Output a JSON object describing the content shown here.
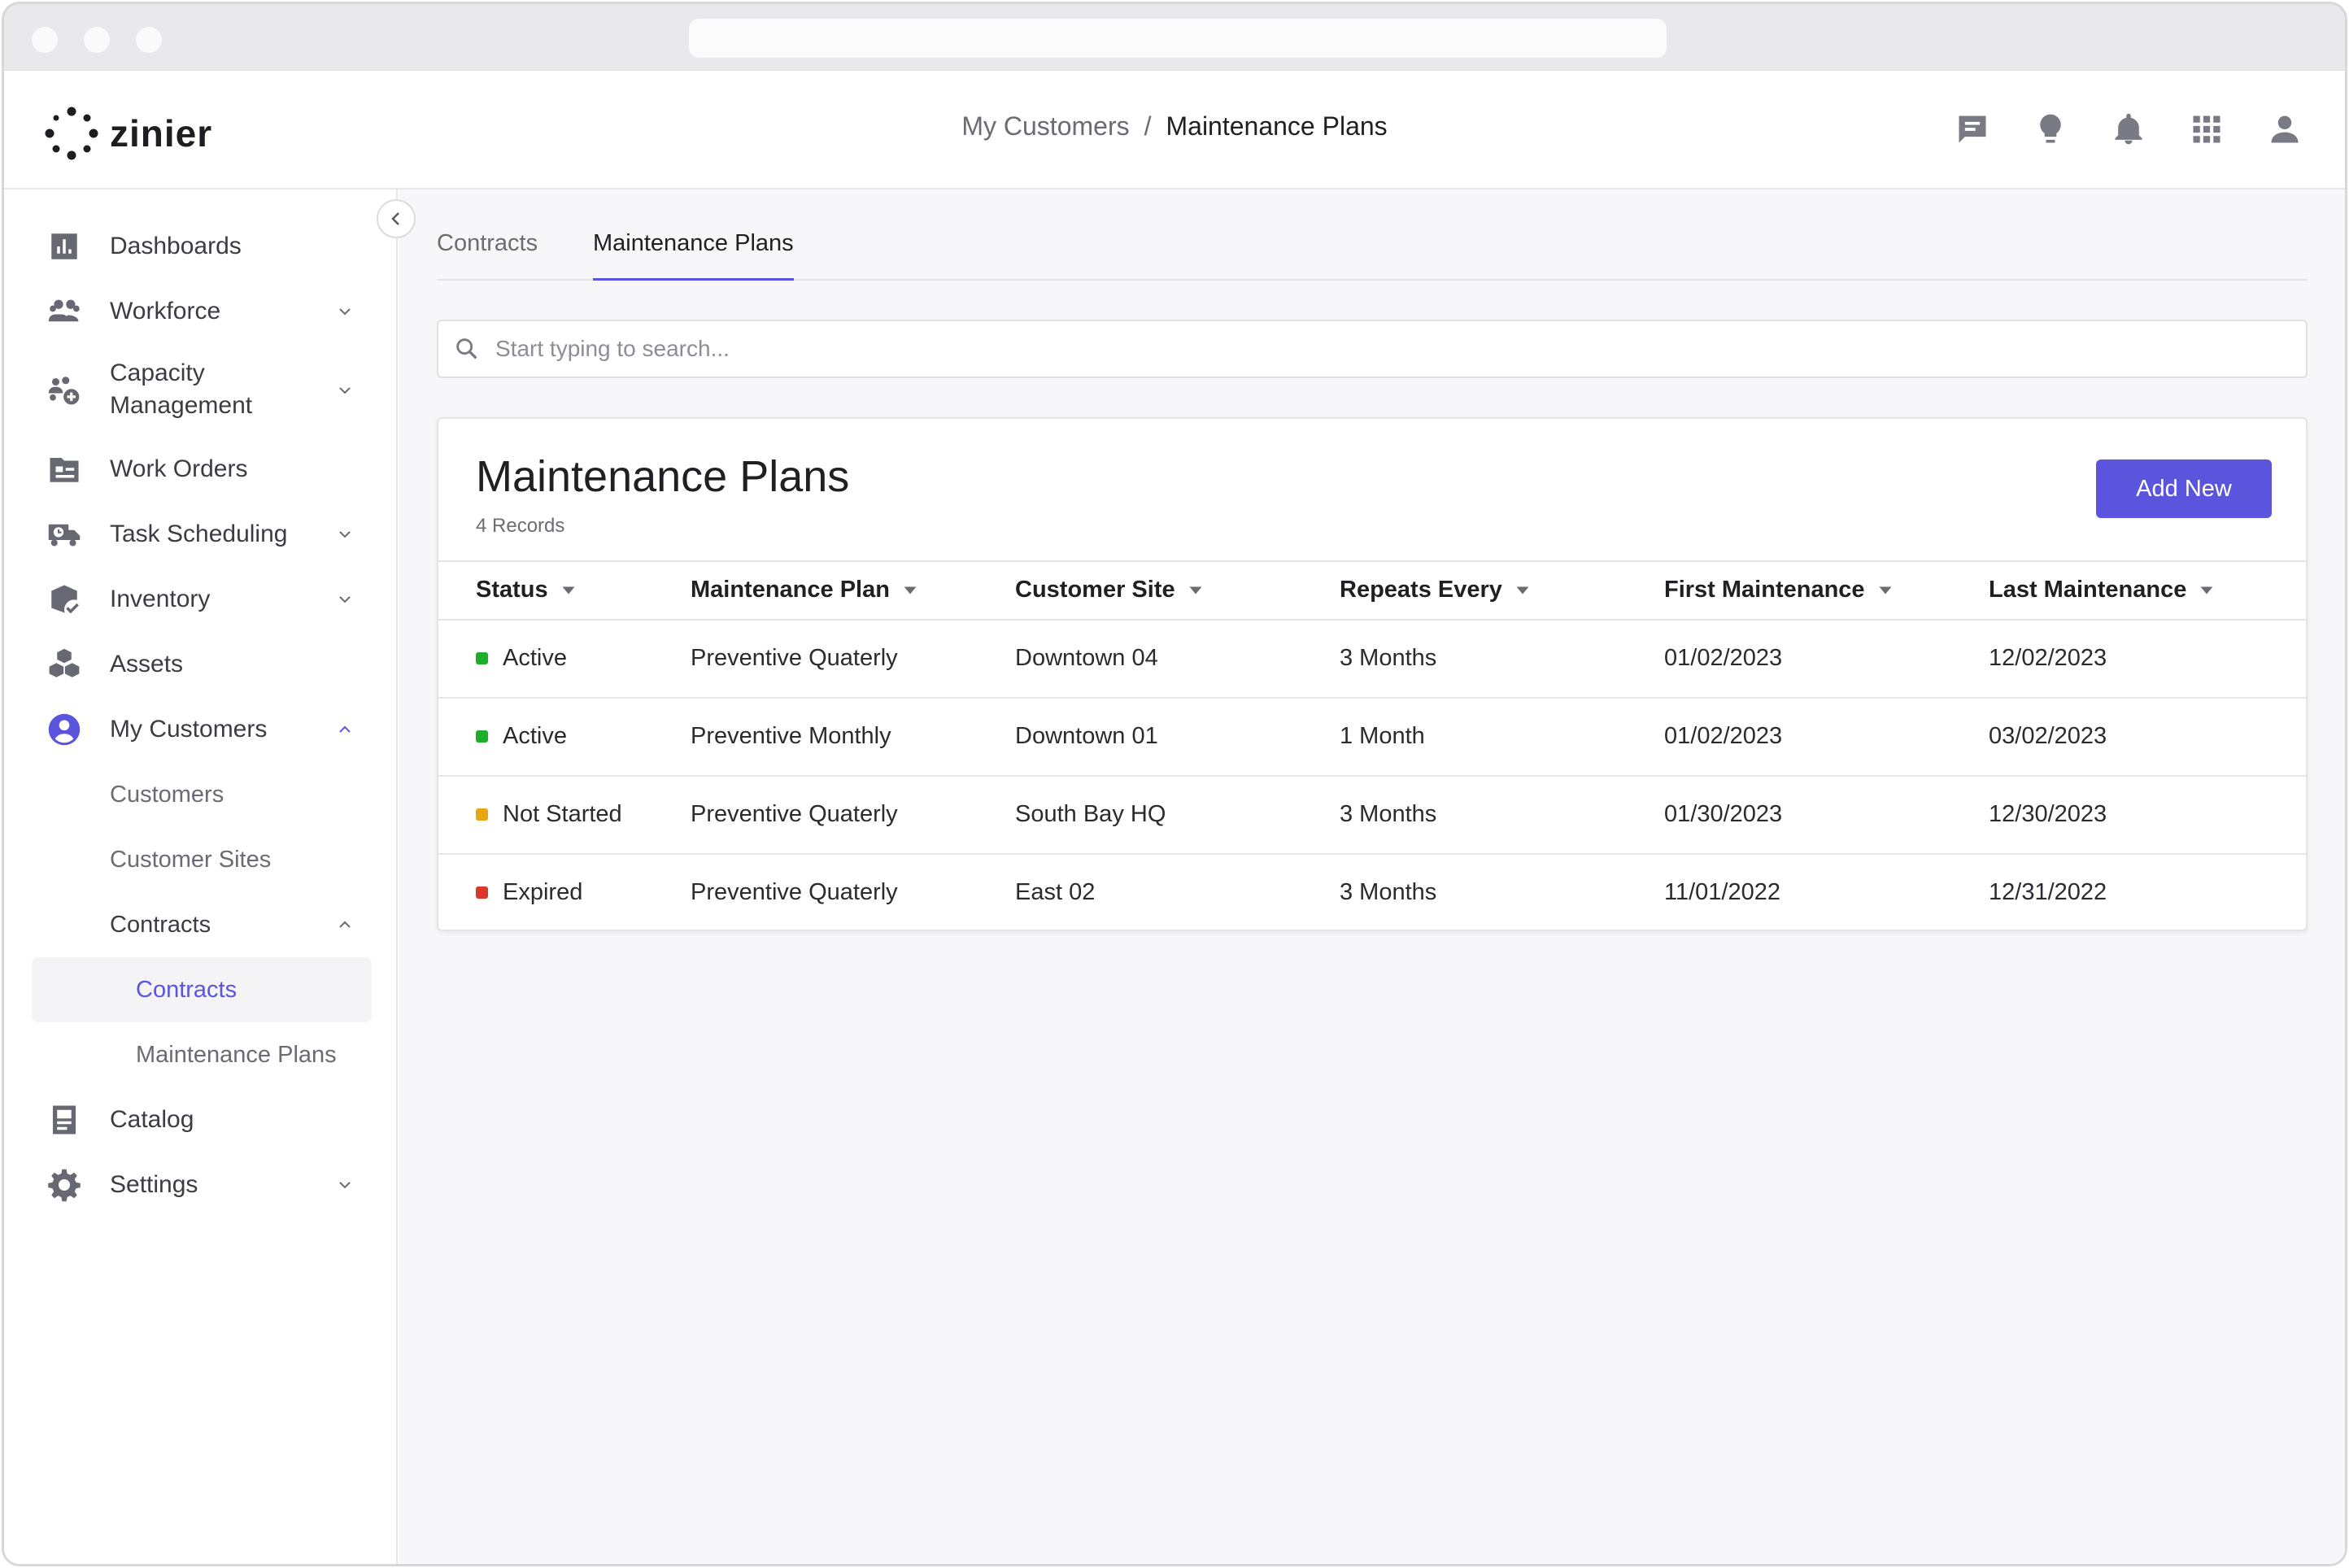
{
  "app": {
    "logo_text": "zinier"
  },
  "breadcrumb": {
    "parent": "My Customers",
    "separator": "/",
    "current": "Maintenance Plans"
  },
  "header_icons": [
    "chat-icon",
    "lightbulb-icon",
    "bell-icon",
    "apps-grid-icon",
    "user-icon"
  ],
  "sidebar": {
    "items": [
      {
        "label": "Dashboards",
        "icon": "bar-chart-icon"
      },
      {
        "label": "Workforce",
        "icon": "people-icon"
      },
      {
        "label_line1": "Capacity",
        "label_line2": "Management",
        "icon": "capacity-icon"
      },
      {
        "label": "Work Orders",
        "icon": "folder-icon"
      },
      {
        "label": "Task Scheduling",
        "icon": "truck-clock-icon"
      },
      {
        "label": "Inventory",
        "icon": "box-check-icon"
      },
      {
        "label": "Assets",
        "icon": "cubes-icon"
      },
      {
        "label": "My Customers",
        "icon": "customer-circle-icon"
      },
      {
        "label": "Catalog",
        "icon": "book-icon"
      },
      {
        "label": "Settings",
        "icon": "gear-icon"
      }
    ],
    "sub_items": {
      "customers": "Customers",
      "customer_sites": "Customer Sites",
      "contracts_group": "Contracts",
      "contracts": "Contracts",
      "maintenance_plans": "Maintenance Plans"
    }
  },
  "tabs": [
    {
      "label": "Contracts",
      "active": false
    },
    {
      "label": "Maintenance Plans",
      "active": true
    }
  ],
  "search": {
    "placeholder": "Start typing to search..."
  },
  "card": {
    "title": "Maintenance Plans",
    "subtitle": "4 Records",
    "add_button": "Add New"
  },
  "table": {
    "columns": [
      "Status",
      "Maintenance Plan",
      "Customer Site",
      "Repeats Every",
      "First Maintenance",
      "Last Maintenance"
    ],
    "rows": [
      {
        "status": "Active",
        "status_color": "#1fae2c",
        "plan": "Preventive Quaterly",
        "site": "Downtown 04",
        "repeats": "3 Months",
        "first": "01/02/2023",
        "last": "12/02/2023"
      },
      {
        "status": "Active",
        "status_color": "#1fae2c",
        "plan": "Preventive Monthly",
        "site": "Downtown 01",
        "repeats": "1 Month",
        "first": "01/02/2023",
        "last": "03/02/2023"
      },
      {
        "status": "Not Started",
        "status_color": "#e8a614",
        "plan": "Preventive Quaterly",
        "site": "South Bay HQ",
        "repeats": "3 Months",
        "first": "01/30/2023",
        "last": "12/30/2023"
      },
      {
        "status": "Expired",
        "status_color": "#d9382f",
        "plan": "Preventive Quaterly",
        "site": "East 02",
        "repeats": "3 Months",
        "first": "11/01/2022",
        "last": "12/31/2022"
      }
    ]
  },
  "colors": {
    "accent": "#5b55de",
    "sidebar_active_text": "#5b55de"
  }
}
